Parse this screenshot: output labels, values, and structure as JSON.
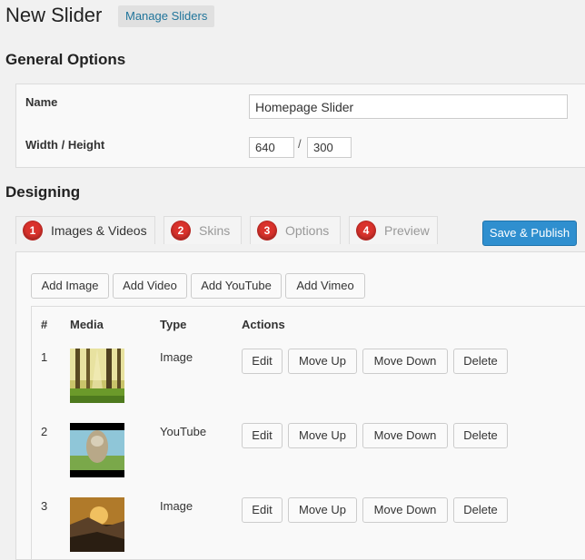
{
  "header": {
    "title": "New Slider",
    "manage_label": "Manage Sliders"
  },
  "general": {
    "heading": "General Options",
    "name_label": "Name",
    "name_value": "Homepage Slider",
    "wh_label": "Width / Height",
    "width_value": "640",
    "separator": "/",
    "height_value": "300"
  },
  "designing": {
    "heading": "Designing",
    "tabs": [
      {
        "num": "1",
        "label": "Images & Videos",
        "active": true
      },
      {
        "num": "2",
        "label": "Skins",
        "active": false
      },
      {
        "num": "3",
        "label": "Options",
        "active": false
      },
      {
        "num": "4",
        "label": "Preview",
        "active": false
      }
    ],
    "save_label": "Save & Publish",
    "add_buttons": [
      "Add Image",
      "Add Video",
      "Add YouTube",
      "Add Vimeo"
    ]
  },
  "table": {
    "headers": [
      "#",
      "Media",
      "Type",
      "Actions"
    ],
    "rows": [
      {
        "num": "1",
        "type": "Image"
      },
      {
        "num": "2",
        "type": "YouTube"
      },
      {
        "num": "3",
        "type": "Image"
      }
    ],
    "actions": [
      "Edit",
      "Move Up",
      "Move Down",
      "Delete"
    ]
  },
  "colors": {
    "accent": "#2f8fcf",
    "tab_badge": "#d9322c",
    "link": "#21759b"
  }
}
